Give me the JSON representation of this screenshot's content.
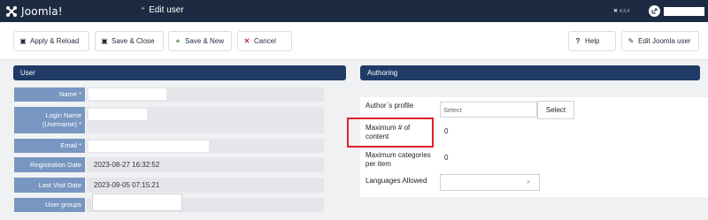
{
  "app": {
    "logo_text": "Joomla!",
    "version": "4.3.4"
  },
  "header": {
    "title": "Edit user"
  },
  "toolbar": {
    "apply_label": "Apply & Reload",
    "save_close_label": "Save & Close",
    "save_new_label": "Save & New",
    "cancel_label": "Cancel",
    "help_label": "Help",
    "edit_joomla_user_label": "Edit Joomla user"
  },
  "user_panel": {
    "title": "User",
    "fields": {
      "name_label": "Name *",
      "login_label": "Login Name (Usemame) *",
      "email_label": "Email *",
      "registration_label": "Registration Date",
      "registration_value": "2023-08-27 16:32:52",
      "last_visit_label": "Last Visit Date",
      "last_visit_value": "2023-09-05 07:15:21",
      "groups_label": "User groups"
    }
  },
  "authoring_panel": {
    "title": "Authoring",
    "profile_label": "Author`s profile",
    "profile_placeholder": "Select",
    "profile_button": "Select",
    "max_content_label": "Maximum # of content",
    "max_content_value": "0",
    "max_categories_label": "Maximum categories per item",
    "max_categories_value": "0",
    "languages_label": "Languages Allowed"
  },
  "colors": {
    "header_bg": "#1c2b41",
    "panel_head": "#1f3b66",
    "label_bg": "#7896c1",
    "highlight": "#e0202a"
  }
}
